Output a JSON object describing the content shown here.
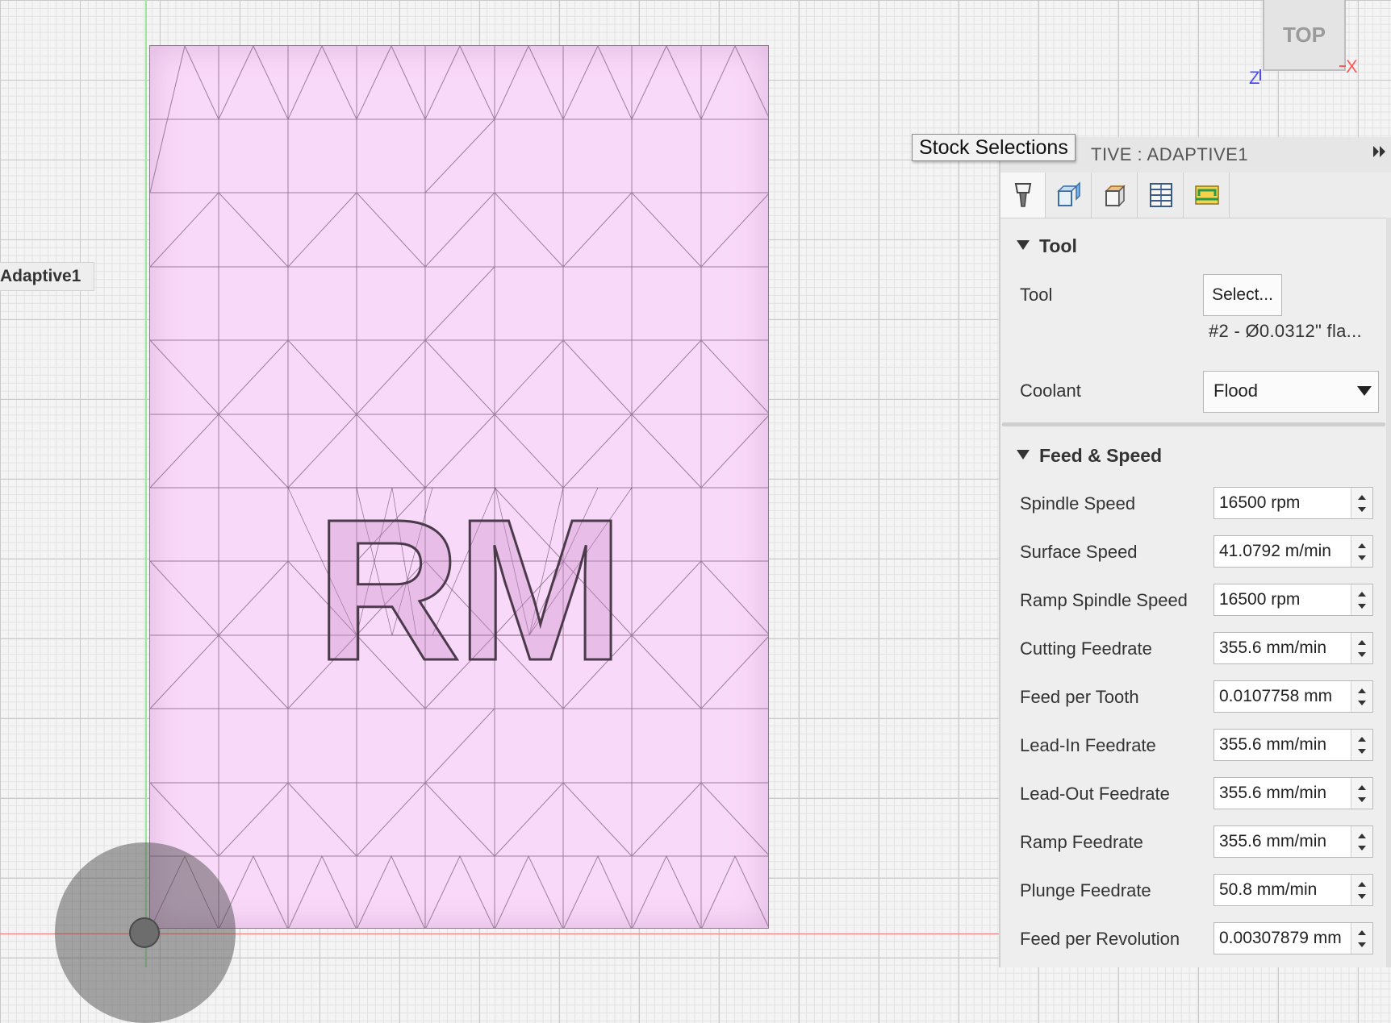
{
  "browser": {
    "operation_label": "Adaptive1"
  },
  "viewcube": {
    "face_label": "TOP",
    "axis_z": "Z",
    "axis_x": "X"
  },
  "model": {
    "engraving_text": "RM"
  },
  "tooltip": {
    "text": "Stock Selections"
  },
  "panel": {
    "title": "TIVE : ADAPTIVE1",
    "expand_icon": "double-chevron-right-icon",
    "tabs": [
      {
        "name": "tool-tab",
        "icon": "tool-icon"
      },
      {
        "name": "geometry-tab",
        "icon": "geometry-icon"
      },
      {
        "name": "heights-tab",
        "icon": "heights-icon"
      },
      {
        "name": "passes-tab",
        "icon": "passes-icon"
      },
      {
        "name": "linking-tab",
        "icon": "linking-icon"
      }
    ],
    "tool_section": {
      "header": "Tool",
      "tool_label": "Tool",
      "select_button": "Select...",
      "tool_description": "#2 - Ø0.0312\" fla...",
      "coolant_label": "Coolant",
      "coolant_value": "Flood"
    },
    "feed_section": {
      "header": "Feed & Speed",
      "rows": [
        {
          "label": "Spindle Speed",
          "value": "16500 rpm"
        },
        {
          "label": "Surface Speed",
          "value": "41.0792 m/min"
        },
        {
          "label": "Ramp Spindle Speed",
          "value": "16500 rpm"
        },
        {
          "label": "Cutting Feedrate",
          "value": "355.6 mm/min"
        },
        {
          "label": "Feed per Tooth",
          "value": "0.0107758 mm"
        },
        {
          "label": "Lead-In Feedrate",
          "value": "355.6 mm/min"
        },
        {
          "label": "Lead-Out Feedrate",
          "value": "355.6 mm/min"
        },
        {
          "label": "Ramp Feedrate",
          "value": "355.6 mm/min"
        },
        {
          "label": "Plunge Feedrate",
          "value": "50.8 mm/min"
        },
        {
          "label": "Feed per Revolution",
          "value": "0.00307879 mm"
        }
      ]
    }
  }
}
